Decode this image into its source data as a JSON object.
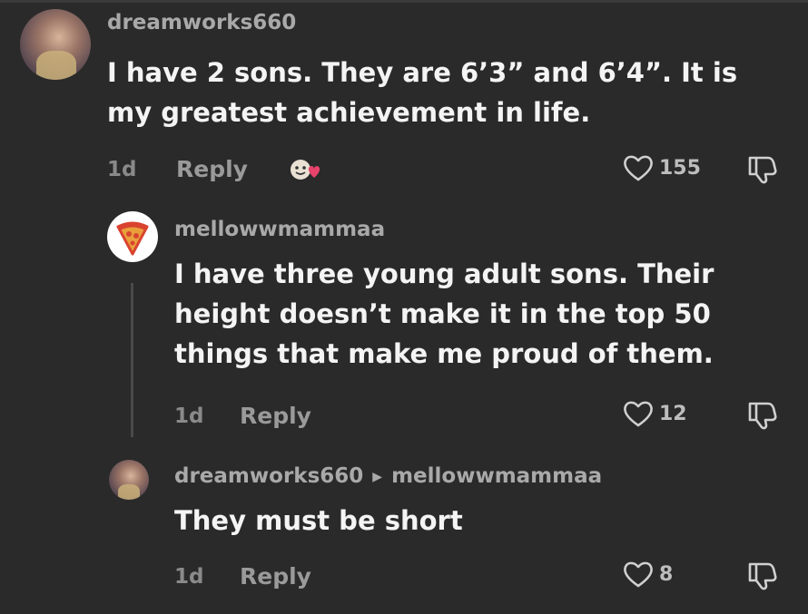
{
  "comments": [
    {
      "username": "dreamworks660",
      "text_lines": [
        "I have 2 sons. They are 6’3” and 6’4”. It is",
        "my greatest achievement in life."
      ],
      "time": "1d",
      "reply_label": "Reply",
      "likes": "155"
    },
    {
      "username": "mellowwmammaa",
      "text_lines": [
        "I have three young adult sons. Their",
        "height doesn’t make it in the top 50",
        "things that make me proud of them."
      ],
      "time": "1d",
      "reply_label": "Reply",
      "likes": "12"
    },
    {
      "username": "dreamworks660",
      "reply_to": "mellowwmammaa",
      "text_lines": [
        "They must be short"
      ],
      "time": "1d",
      "reply_label": "Reply",
      "likes": "8"
    }
  ],
  "icons": {
    "like": "heart-icon",
    "dislike": "thumbs-down-icon",
    "reply_arrow": "right-triangle-icon",
    "sticker": "smiling-face-sticker-icon"
  },
  "colors": {
    "background": "#2a2a2a",
    "username": "#a9a9a9",
    "text": "#f4f4f4",
    "meta": "#8a8a8a",
    "sticker_heart": "#e8436b",
    "pizza_icon": "#d9432f"
  }
}
